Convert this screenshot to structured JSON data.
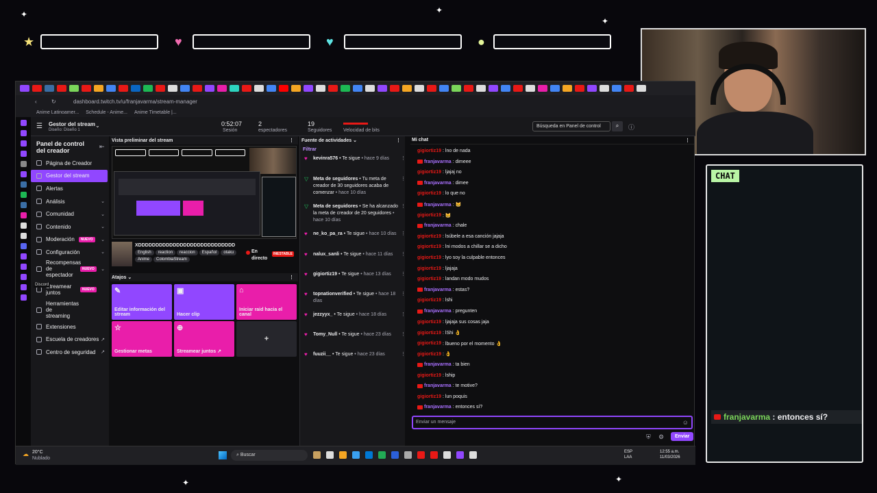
{
  "overlay": {
    "chat_tag": "CHAT",
    "last_user": "franjavarma",
    "last_sep": ":",
    "last_text": "entonces sí?"
  },
  "browser": {
    "url": "dashboard.twitch.tv/u/franjavarma/stream-manager",
    "bookmarks": [
      "Anime Latinoamer...",
      "Schedule - Anime...",
      "Anime Timetable |..."
    ]
  },
  "topbar": {
    "title": "Gestor del stream",
    "subtitle": "Diseño: Diseño 1",
    "session_value": "0:52:07",
    "session_label": "Sesión",
    "viewers_value": "2",
    "viewers_label": "espectadores",
    "followers_value": "19",
    "followers_label": "Seguidores",
    "bitrate_label": "Velocidad de bits",
    "search_placeholder": "Búsqueda en Panel de control"
  },
  "sidebar": {
    "title": "Panel de control del creador",
    "items": [
      {
        "label": "Página de Creador"
      },
      {
        "label": "Gestor del stream"
      },
      {
        "label": "Alertas"
      },
      {
        "label": "Análisis"
      },
      {
        "label": "Comunidad"
      },
      {
        "label": "Contenido"
      },
      {
        "label": "Moderación",
        "badge": "NUEVO"
      },
      {
        "label": "Configuración"
      },
      {
        "label": "Recompensas de espectador",
        "badge": "NUEVO"
      },
      {
        "label": "Streamear juntos",
        "badge": "NUEVO"
      },
      {
        "label": "Herramientas de streaming"
      },
      {
        "label": "Extensiones"
      },
      {
        "label": "Escuela de creadores"
      },
      {
        "label": "Centro de seguridad"
      }
    ],
    "tooltip": "Discord"
  },
  "preview": {
    "header": "Vista preliminar del stream",
    "stream_title": "XDDDDDDDDDDDDDDDDDDDDDDDDDDDD",
    "tags": [
      "English",
      "reaction",
      "reaccion",
      "Español",
      "otaku",
      "Anime",
      "ColombiaStream"
    ],
    "status": "En directo",
    "status_badge": "INESTABLE"
  },
  "shortcuts": {
    "header": "Atajos",
    "items": [
      {
        "label": "Editar información del stream",
        "color": "#9147ff"
      },
      {
        "label": "Hacer clip",
        "color": "#9147ff"
      },
      {
        "label": "Iniciar raid hacia el canal",
        "color": "#e91eaa"
      },
      {
        "label": "Gestionar metas",
        "color": "#e91eaa"
      },
      {
        "label": "Streamear juntos ↗",
        "color": "#e91eaa"
      },
      {
        "label": "+",
        "color": "#26262c"
      }
    ]
  },
  "feed": {
    "header": "Fuente de actividades",
    "filter": "Filtrar",
    "items": [
      {
        "user": "kevinra576",
        "action": " • Te sigue",
        "time": " • hace 9 días"
      },
      {
        "user": "Meta de seguidores",
        "action": " • Tu meta de creador de 30 seguidores acaba de comenzar",
        "time": " • hace 10 días"
      },
      {
        "user": "Meta de seguidores",
        "action": " • Se ha alcanzado la meta de creador de 20 seguidores",
        "time": " • hace 10 días"
      },
      {
        "user": "ne_ko_pa_ra",
        "action": " • Te sigue",
        "time": " • hace 10 días"
      },
      {
        "user": "nalux_sanli",
        "action": " • Te sigue",
        "time": " • hace 11 días"
      },
      {
        "user": "gigiortiz19",
        "action": " • Te sigue",
        "time": " • hace 13 días"
      },
      {
        "user": "topnationverified",
        "action": " • Te sigue",
        "time": " • hace 18 días"
      },
      {
        "user": "jezzyyx_",
        "action": " • Te sigue",
        "time": " • hace 18 días"
      },
      {
        "user": "Tomy_Null",
        "action": " • Te sigue",
        "time": " • hace 23 días"
      },
      {
        "user": "fuuzii__",
        "action": " • Te sigue",
        "time": " • hace 23 días"
      }
    ]
  },
  "chat": {
    "header": "Mi chat",
    "placeholder": "Enviar un mensaje",
    "send": "Enviar",
    "messages": [
      {
        "user": "gigiortiz19",
        "text": ": lno de nada"
      },
      {
        "user": "franjavarma",
        "text": ": dimeee",
        "vip": true
      },
      {
        "user": "gigiortiz19",
        "text": ": ljajaj no"
      },
      {
        "user": "franjavarma",
        "text": ": dimee",
        "vip": true
      },
      {
        "user": "gigiortiz19",
        "text": ": lo que no"
      },
      {
        "user": "franjavarma",
        "text": ": 😸",
        "vip": true
      },
      {
        "user": "gigiortiz19",
        "text": ": 😸"
      },
      {
        "user": "franjavarma",
        "text": ": chale",
        "vip": true
      },
      {
        "user": "gigiortiz19",
        "text": ": lsúbele a esa canción jajaja"
      },
      {
        "user": "gigiortiz19",
        "text": ": lni modos a chillar se a dicho"
      },
      {
        "user": "gigiortiz19",
        "text": ": lyo soy la culpable entonces"
      },
      {
        "user": "gigiortiz19",
        "text": ": ljajaja"
      },
      {
        "user": "gigiortiz19",
        "text": ": landan modo mudos"
      },
      {
        "user": "franjavarma",
        "text": ": estas?",
        "vip": true
      },
      {
        "user": "gigiortiz19",
        "text": ": lshi"
      },
      {
        "user": "franjavarma",
        "text": ": pregunten",
        "vip": true
      },
      {
        "user": "gigiortiz19",
        "text": ": ljajaja sus cosas jaja"
      },
      {
        "user": "gigiortiz19",
        "text": ": lShi 👌"
      },
      {
        "user": "gigiortiz19",
        "text": ": lbueno por el momento 👌"
      },
      {
        "user": "gigiortiz19",
        "text": ": 👌"
      },
      {
        "user": "franjavarma",
        "text": ": ta bien",
        "vip": true
      },
      {
        "user": "gigiortiz19",
        "text": ": lship"
      },
      {
        "user": "franjavarma",
        "text": ": te motive?",
        "vip": true
      },
      {
        "user": "gigiortiz19",
        "text": ": lun poquis"
      },
      {
        "user": "franjavarma",
        "text": ": entonces sí?",
        "vip": true
      }
    ]
  },
  "taskbar": {
    "temp": "20°C",
    "weather": "Nublado",
    "search": "Buscar",
    "lang1": "ESP",
    "lang2": "LAA",
    "time": "12:55 a.m.",
    "date": "11/03/2026"
  },
  "colors": {
    "twitch_purple": "#9147ff",
    "pink": "#e91eaa",
    "chat_user_red": "#e91916",
    "chat_user_purple": "#a970ff",
    "overlay_green": "#7bd65a"
  }
}
